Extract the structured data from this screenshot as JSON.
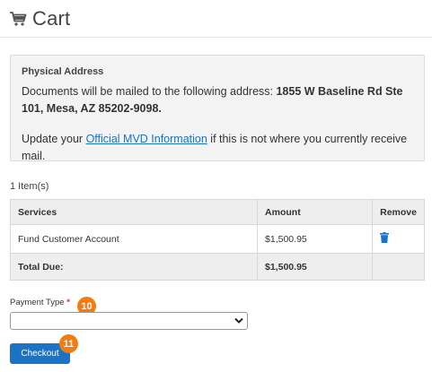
{
  "header": {
    "title": "Cart",
    "icon": "cart-icon"
  },
  "address": {
    "heading": "Physical Address",
    "text_prefix": "Documents will be mailed to the following address: ",
    "address_bold": "1855 W Baseline Rd Ste 101, Mesa, AZ 85202-9098.",
    "update_prefix": "Update your ",
    "update_link": "Official MVD Information",
    "update_suffix": " if this is not where you currently receive mail."
  },
  "cart": {
    "item_count": "1 Item(s)",
    "columns": {
      "services": "Services",
      "amount": "Amount",
      "remove": "Remove"
    },
    "rows": [
      {
        "service": "Fund Customer Account",
        "amount": "$1,500.95",
        "remove_icon": "trash-icon"
      }
    ],
    "total_label": "Total Due:",
    "total_value": "$1,500.95"
  },
  "payment": {
    "label": "Payment Type",
    "required_marker": "*",
    "selected_value": ""
  },
  "checkout": {
    "label": "Checkout"
  },
  "badges": {
    "payment_step": "10",
    "checkout_step": "11"
  },
  "colors": {
    "accent": "#1a73c4",
    "badge": "#f07c12",
    "required": "#d9342b"
  }
}
